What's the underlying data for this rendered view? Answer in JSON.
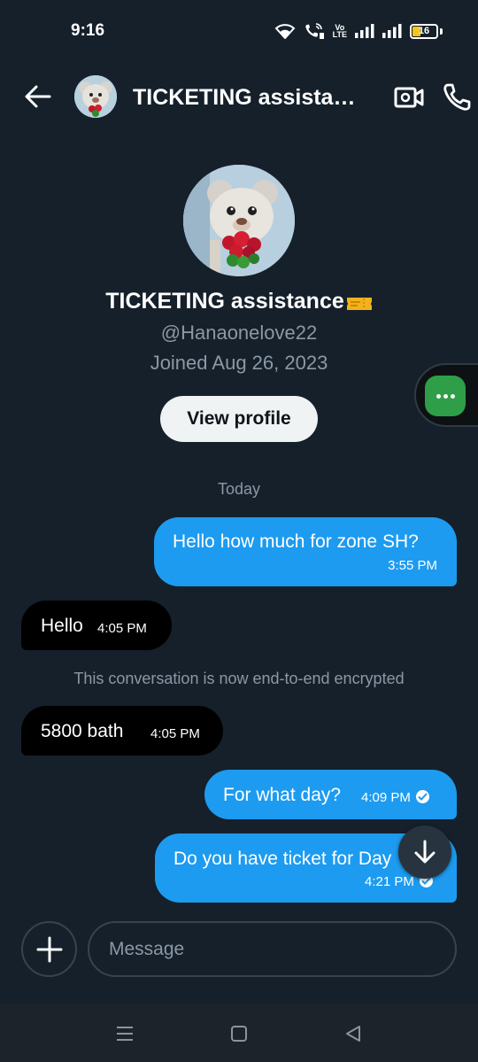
{
  "status_bar": {
    "time": "9:16",
    "volte_line1": "Vo",
    "volte_line2": "LTE",
    "battery": "16",
    "battery_level": 0.16
  },
  "header": {
    "title": "TICKETING assistance",
    "icons": [
      "back-arrow-icon",
      "video-icon",
      "phone-icon"
    ]
  },
  "profile": {
    "name": "TICKETING assistance",
    "handle": "@Hanaonelove22",
    "joined": "Joined Aug 26, 2023",
    "view_profile_label": "View profile"
  },
  "conversation": {
    "day_label": "Today",
    "encrypted_notice": "This conversation is now end-to-end encrypted",
    "messages": [
      {
        "text": "Hello how much for zone SH?",
        "time": "3:55 PM",
        "direction": "out"
      },
      {
        "text": "Hello",
        "time": "4:05 PM",
        "direction": "in"
      },
      {
        "text": "5800 bath",
        "time": "4:05 PM",
        "direction": "in"
      },
      {
        "text": "For what day?",
        "time": "4:09 PM",
        "direction": "out",
        "read": true
      },
      {
        "text": "Do you have ticket for Day",
        "time": "4:21 PM",
        "direction": "out",
        "read": true
      }
    ]
  },
  "composer": {
    "placeholder": "Message"
  },
  "colors": {
    "background": "#15202b",
    "outgoing_bubble": "#1d9bf0",
    "incoming_bubble": "#000000",
    "muted_text": "#8b98a5",
    "floating_bubble": "#2e9e48"
  }
}
